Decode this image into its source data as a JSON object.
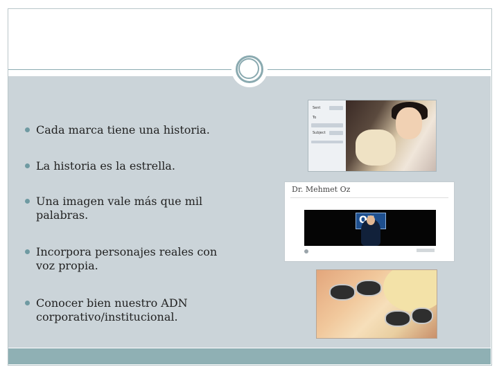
{
  "slide": {
    "bullets": [
      "Cada marca tiene una historia.",
      "La historia es la estrella.",
      "Una imagen vale más que mil palabras.",
      "Incorpora personajes reales con voz propia.",
      "Conocer bien nuestro ADN corporativo/institucional."
    ]
  },
  "images": {
    "email_photo": {
      "labels": [
        "Sent",
        "To",
        "Subject"
      ]
    },
    "oz_page": {
      "title": "Dr. Mehmet Oz",
      "logo_text": "OZ"
    }
  },
  "colors": {
    "content_background": "#cbd4d9",
    "footer_band": "#8fb0b4",
    "ornament": "#8aaab0",
    "bullet": "#6f9aa2"
  }
}
